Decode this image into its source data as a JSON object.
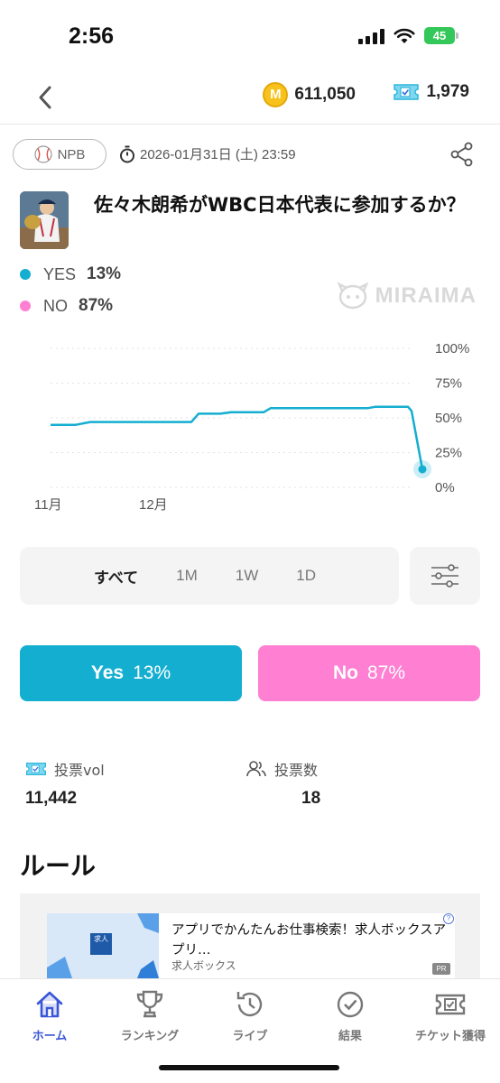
{
  "status_bar": {
    "time": "2:56",
    "battery": "45"
  },
  "header": {
    "coins": "611,050",
    "tickets": "1,979"
  },
  "market": {
    "category": "NPB",
    "deadline": "2026-01月31日 (土) 23:59",
    "title": "佐々木朗希がWBC日本代表に参加するか？",
    "options": [
      {
        "label": "YES",
        "percent": "13%",
        "color": "#14aed0"
      },
      {
        "label": "NO",
        "percent": "87%",
        "color": "#ff7fd3"
      }
    ],
    "watermark": "MIRAIMA"
  },
  "chart_data": {
    "type": "line",
    "y_ticks": [
      "100%",
      "75%",
      "50%",
      "25%",
      "0%"
    ],
    "x_ticks": [
      "11月",
      "12月"
    ],
    "ylim": [
      0,
      100
    ],
    "grid": true,
    "series": [
      {
        "color": "#14aed0",
        "points": [
          [
            0,
            45
          ],
          [
            0.07,
            45
          ],
          [
            0.11,
            47
          ],
          [
            0.39,
            47
          ],
          [
            0.41,
            53
          ],
          [
            0.47,
            53
          ],
          [
            0.5,
            54
          ],
          [
            0.59,
            54
          ],
          [
            0.61,
            57
          ],
          [
            0.88,
            57
          ],
          [
            0.9,
            58
          ],
          [
            0.99,
            58
          ],
          [
            1.0,
            55
          ],
          [
            1.02,
            13
          ]
        ]
      }
    ]
  },
  "range": {
    "items": [
      "すべて",
      "1M",
      "1W",
      "1D"
    ],
    "active": "すべて"
  },
  "vote": {
    "yes_label": "Yes",
    "yes_pct": "13%",
    "no_label": "No",
    "no_pct": "87%"
  },
  "stats": {
    "vol_label": "投票vol",
    "vol_value": "11,442",
    "count_label": "投票数",
    "count_value": "18"
  },
  "rules_heading": "ルール",
  "ad": {
    "title": "アプリでかんたんお仕事検索！求人ボックスアプリ…",
    "source": "求人ボックス",
    "logo": "求人",
    "pr": "PR",
    "info": "?"
  },
  "nav": [
    {
      "label": "ホーム",
      "icon": "home-icon",
      "active": true
    },
    {
      "label": "ランキング",
      "icon": "trophy-icon",
      "active": false
    },
    {
      "label": "ライブ",
      "icon": "history-icon",
      "active": false
    },
    {
      "label": "結果",
      "icon": "check-circle-icon",
      "active": false
    },
    {
      "label": "チケット獲得",
      "icon": "ticket-icon",
      "active": false
    }
  ]
}
